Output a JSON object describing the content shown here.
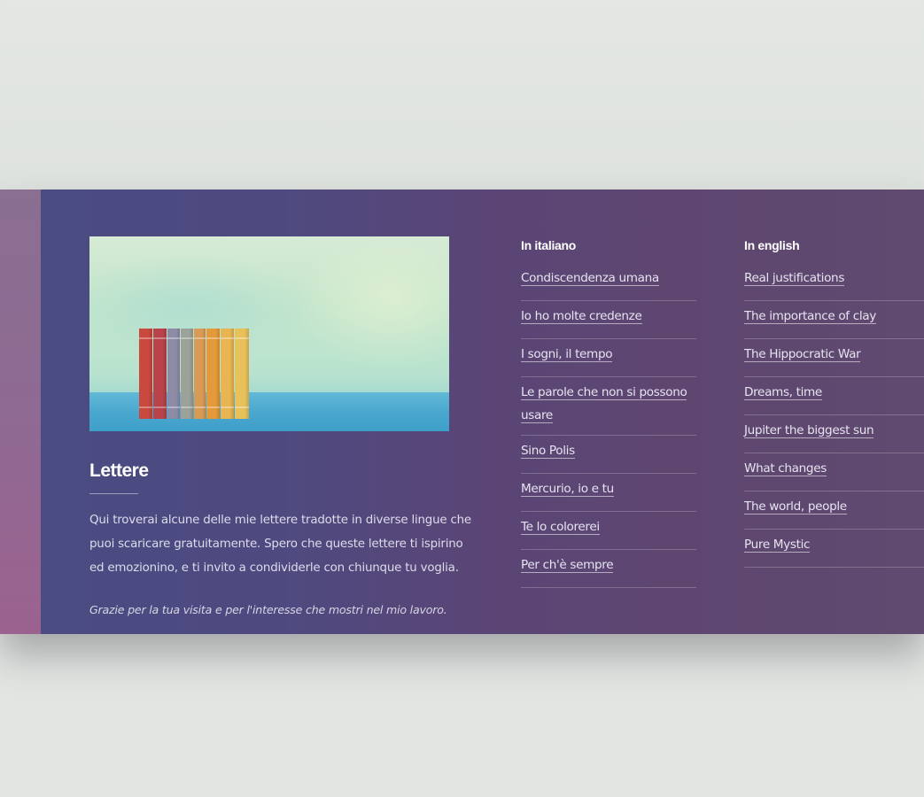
{
  "section": {
    "title": "Lettere",
    "description": "Qui troverai alcune delle mie lettere tradotte in diverse lingue che puoi scaricare gratuitamente. Spero che queste lettere ti ispirino ed emozionino, e ti invito a condividerle con chiunque tu voglia.",
    "thanks": "Grazie per la tua visita e per l'interesse che mostri nel mio lavoro."
  },
  "italian": {
    "heading": "In italiano",
    "links": [
      "Condiscendenza umana",
      "Io ho molte credenze",
      "I sogni, il tempo",
      "Le parole che non si possono usare",
      "Sino Polis",
      "Mercurio, io e tu",
      "Te lo colorerei",
      "Per ch'è sempre"
    ]
  },
  "english": {
    "heading": "In english",
    "links": [
      "Real justifications",
      "The importance of clay",
      "The Hippocratic War",
      "Dreams, time",
      "Jupiter the biggest sun",
      "What changes",
      "The world, people",
      "Pure Mystic"
    ]
  },
  "image": {
    "subject": "books-on-shelf",
    "book_colors": [
      "#c9493f",
      "#b8434a",
      "#8e8ba6",
      "#9aa29a",
      "#d99a56",
      "#e49a3a",
      "#e8b552",
      "#e9c15b"
    ]
  },
  "colors": {
    "banner_left": "#4a4c82",
    "banner_right": "#604a6f",
    "accent_strip": "#9b628f",
    "page_bg": "#e2e5e2"
  }
}
